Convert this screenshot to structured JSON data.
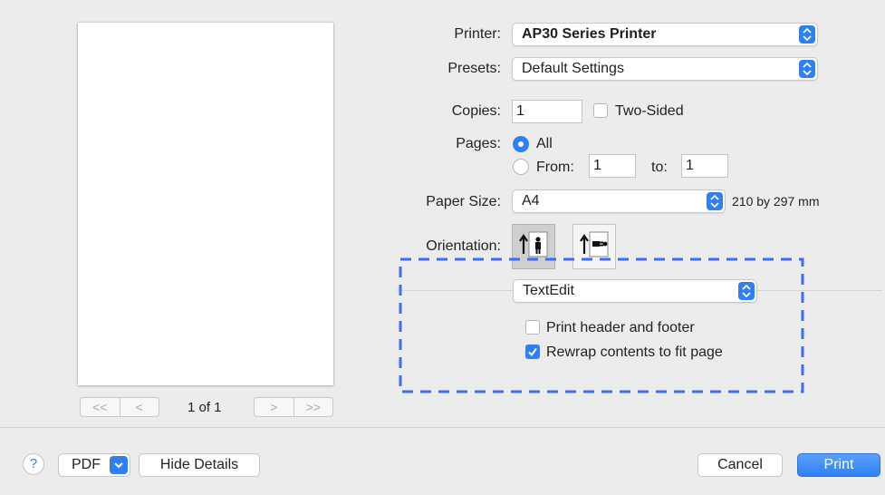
{
  "printer": {
    "label": "Printer:",
    "value": "AP30 Series Printer"
  },
  "presets": {
    "label": "Presets:",
    "value": "Default Settings"
  },
  "copies": {
    "label": "Copies:",
    "value": "1",
    "two_sided_label": "Two-Sided",
    "two_sided_checked": false
  },
  "pages": {
    "label": "Pages:",
    "all_label": "All",
    "all_selected": true,
    "from_label": "From:",
    "from_value": "1",
    "to_label": "to:",
    "to_value": "1"
  },
  "paper_size": {
    "label": "Paper Size:",
    "value": "A4",
    "dimensions": "210 by 297 mm"
  },
  "orientation": {
    "label": "Orientation:",
    "selected": "portrait"
  },
  "app_options": {
    "popup_value": "TextEdit",
    "print_header_footer_label": "Print header and footer",
    "print_header_footer_checked": false,
    "rewrap_label": "Rewrap contents to fit page",
    "rewrap_checked": true
  },
  "preview_nav": {
    "first": "<<",
    "prev": "<",
    "page_indicator": "1 of 1",
    "next": ">",
    "last": ">>"
  },
  "footer": {
    "help": "?",
    "pdf_label": "PDF",
    "hide_details_label": "Hide Details",
    "cancel_label": "Cancel",
    "print_label": "Print"
  },
  "colors": {
    "accent": "#2f7ff5",
    "annotation_dash": "#3d6ef2",
    "background": "#ececec"
  },
  "icons": [
    "stepper-icon",
    "checkmark-icon",
    "portrait-orientation-icon",
    "landscape-orientation-icon",
    "chevron-down-icon",
    "help-icon"
  ]
}
